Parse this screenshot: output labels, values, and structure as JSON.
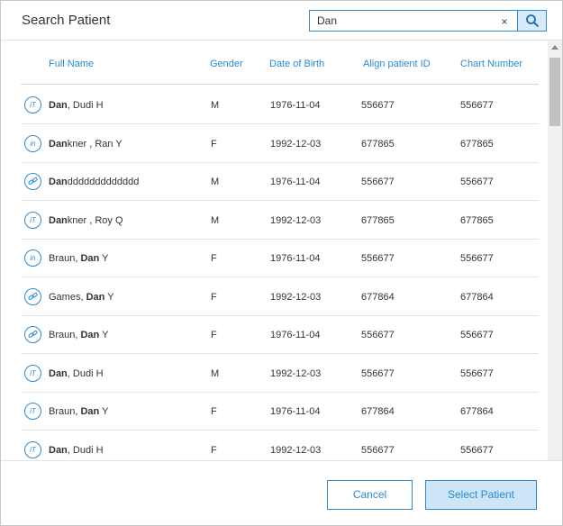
{
  "dialog": {
    "title": "Search Patient"
  },
  "search": {
    "value": "Dan",
    "clear_label": "×"
  },
  "table": {
    "headers": [
      "Full Name",
      "Gender",
      "Date of Birth",
      "Align patient ID",
      "Chart Number"
    ],
    "rows": [
      {
        "icon": "iT-icon",
        "icon_text": "iT",
        "name_bold": "Dan",
        "name_rest": ", Dudi H",
        "name_prefix": "",
        "gender": "M",
        "dob": "1976-11-04",
        "align_id": "556677",
        "chart": "556677"
      },
      {
        "icon": "in-icon",
        "icon_text": "in",
        "name_bold": "Dan",
        "name_rest": "kner , Ran Y",
        "name_prefix": "",
        "gender": "F",
        "dob": "1992-12-03",
        "align_id": "677865",
        "chart": "677865"
      },
      {
        "icon": "link-icon",
        "icon_text": "",
        "name_bold": "Dan",
        "name_rest": "ddddddddddddd",
        "name_prefix": "",
        "gender": "M",
        "dob": "1976-11-04",
        "align_id": "556677",
        "chart": "556677"
      },
      {
        "icon": "iT-icon",
        "icon_text": "iT",
        "name_bold": "Dan",
        "name_rest": "kner , Roy Q",
        "name_prefix": "",
        "gender": "M",
        "dob": "1992-12-03",
        "align_id": "677865",
        "chart": "677865"
      },
      {
        "icon": "in-icon",
        "icon_text": "in",
        "name_bold": "Dan",
        "name_rest": " Y",
        "name_prefix": "Braun, ",
        "gender": "F",
        "dob": "1976-11-04",
        "align_id": "556677",
        "chart": "556677"
      },
      {
        "icon": "link-icon",
        "icon_text": "",
        "name_bold": "Dan",
        "name_rest": " Y",
        "name_prefix": "Games, ",
        "gender": "F",
        "dob": "1992-12-03",
        "align_id": "677864",
        "chart": "677864"
      },
      {
        "icon": "link-icon",
        "icon_text": "",
        "name_bold": "Dan",
        "name_rest": " Y",
        "name_prefix": "Braun, ",
        "gender": "F",
        "dob": "1976-11-04",
        "align_id": "556677",
        "chart": "556677"
      },
      {
        "icon": "iT-icon",
        "icon_text": "iT",
        "name_bold": "Dan",
        "name_rest": ", Dudi H",
        "name_prefix": "",
        "gender": "M",
        "dob": "1992-12-03",
        "align_id": "556677",
        "chart": "556677"
      },
      {
        "icon": "iT-icon",
        "icon_text": "iT",
        "name_bold": "Dan",
        "name_rest": " Y",
        "name_prefix": "Braun, ",
        "gender": "F",
        "dob": "1976-11-04",
        "align_id": "677864",
        "chart": "677864"
      },
      {
        "icon": "iT-icon",
        "icon_text": "iT",
        "name_bold": "Dan",
        "name_rest": ", Dudi H",
        "name_prefix": "",
        "gender": "F",
        "dob": "1992-12-03",
        "align_id": "556677",
        "chart": "556677"
      }
    ]
  },
  "footer": {
    "cancel_label": "Cancel",
    "select_label": "Select Patient"
  },
  "colors": {
    "accent": "#2b8ad1",
    "select_button_bg": "#cde5f6"
  }
}
